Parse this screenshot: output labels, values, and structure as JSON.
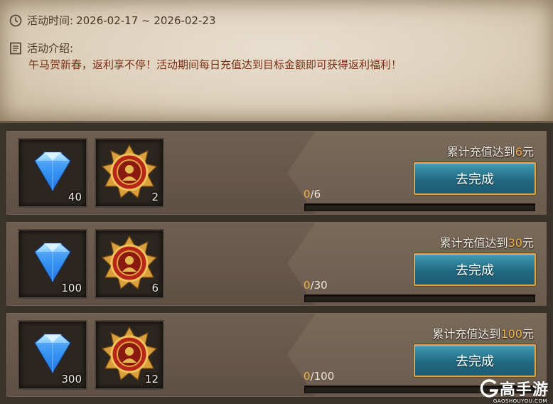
{
  "event": {
    "time_label": "活动时间:",
    "time_range": "2026-02-17 ~ 2026-02-23",
    "intro_label": "活动介绍:",
    "intro_text": "午马贺新春，返利享不停！活动期间每日充值达到目标金额即可获得返利福利！"
  },
  "rows": [
    {
      "req_prefix": "累计充值达到",
      "req_amount": "6",
      "req_suffix": "元",
      "rewards": [
        {
          "icon": "diamond-icon",
          "count": "40"
        },
        {
          "icon": "medal-icon",
          "count": "2"
        }
      ],
      "progress_current": "0",
      "progress_total": "/6",
      "progress_fraction": 0,
      "button": "去完成"
    },
    {
      "req_prefix": "累计充值达到",
      "req_amount": "30",
      "req_suffix": "元",
      "rewards": [
        {
          "icon": "diamond-icon",
          "count": "100"
        },
        {
          "icon": "medal-icon",
          "count": "6"
        }
      ],
      "progress_current": "0",
      "progress_total": "/30",
      "progress_fraction": 0,
      "button": "去完成"
    },
    {
      "req_prefix": "累计充值达到",
      "req_amount": "100",
      "req_suffix": "元",
      "rewards": [
        {
          "icon": "diamond-icon",
          "count": "300"
        },
        {
          "icon": "medal-icon",
          "count": "12"
        }
      ],
      "progress_current": "0",
      "progress_total": "/100",
      "progress_fraction": 0,
      "button": "去完成"
    }
  ],
  "watermark": {
    "text": "高手游",
    "sub": "GAOSHOUYOU.COM"
  },
  "colors": {
    "accent_gold": "#f0b24a",
    "button_teal": "#2a7f98",
    "intro_text": "#7a2e14"
  }
}
